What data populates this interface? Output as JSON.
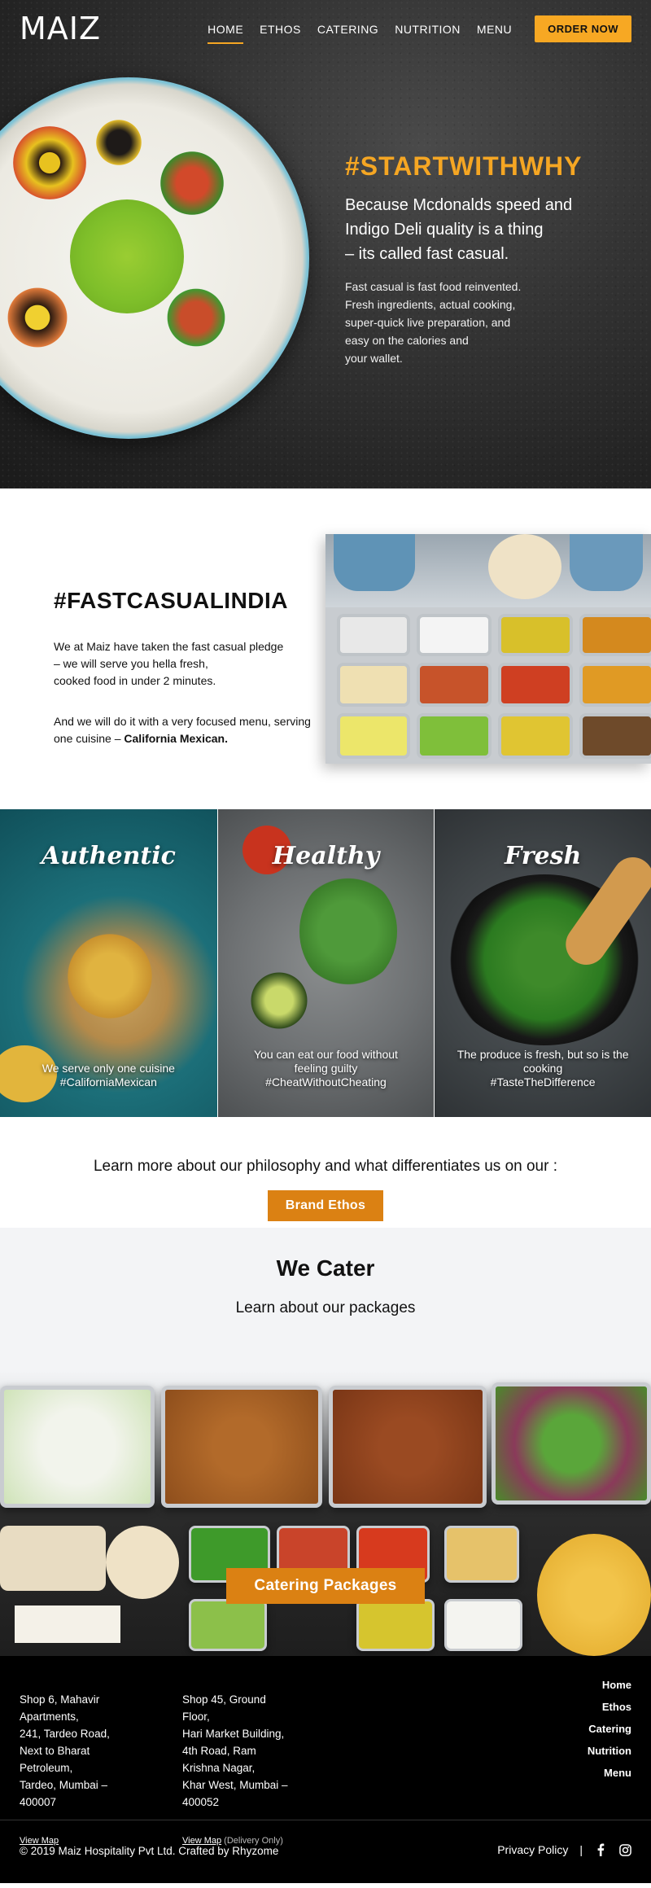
{
  "brand": {
    "logo_text": "MAIZ"
  },
  "nav": {
    "items": [
      "HOME",
      "ETHOS",
      "CATERING",
      "NUTRITION",
      "MENU"
    ],
    "active": "HOME",
    "order_label": "ORDER NOW"
  },
  "hero": {
    "tagline": "#STARTWITHWHY",
    "subtitle": "Because Mcdonalds speed and\nIndigo Deli quality is a thing\n– its called fast casual.",
    "body": "Fast casual is fast food reinvented.\nFresh ingredients, actual cooking,\nsuper-quick live preparation, and\neasy on the calories and\nyour wallet."
  },
  "fast_casual": {
    "title": "#FASTCASUALINDIA",
    "p1": "We at Maiz have taken the fast casual pledge\n– we will serve you hella fresh,\ncooked food in under 2 minutes.",
    "p2_lead": "And we will do it with a very focused menu, serving one cuisine – ",
    "p2_bold": "California Mexican."
  },
  "pillars": [
    {
      "title": "Authentic",
      "text": "We serve only one cuisine\n#CaliforniaMexican"
    },
    {
      "title": "Healthy",
      "text": "You can eat our food without\nfeeling guilty\n#CheatWithoutCheating"
    },
    {
      "title": "Fresh",
      "text": "The produce is fresh, but so is the\ncooking\n#TasteTheDifference"
    }
  ],
  "ethos_cta": {
    "text": "Learn more about our philosophy and what differentiates us on our :",
    "button": "Brand Ethos"
  },
  "cater": {
    "title": "We Cater",
    "subtitle": "Learn about our packages",
    "button": "Catering Packages"
  },
  "footer": {
    "address1": "Shop 6, Mahavir\nApartments,\n241, Tardeo Road,\nNext to Bharat\nPetroleum,\nTardeo, Mumbai –\n400007",
    "address1_link": "View Map",
    "address2": "Shop 45, Ground\nFloor,\nHari Market Building,\n4th Road, Ram\nKrishna Nagar,\nKhar West, Mumbai –\n400052",
    "address2_link": "View Map",
    "address2_note": " (Delivery Only)",
    "links": [
      "Home",
      "Ethos",
      "Catering",
      "Nutrition",
      "Menu"
    ],
    "copyright": "© 2019 Maiz Hospitality Pvt Ltd. Crafted by Rhyzome",
    "privacy": "Privacy Policy",
    "separator": "|",
    "social": [
      "facebook-icon",
      "instagram-icon"
    ]
  },
  "colors": {
    "accent": "#f7a823",
    "button": "#db8113",
    "footer_bg": "#000000"
  }
}
